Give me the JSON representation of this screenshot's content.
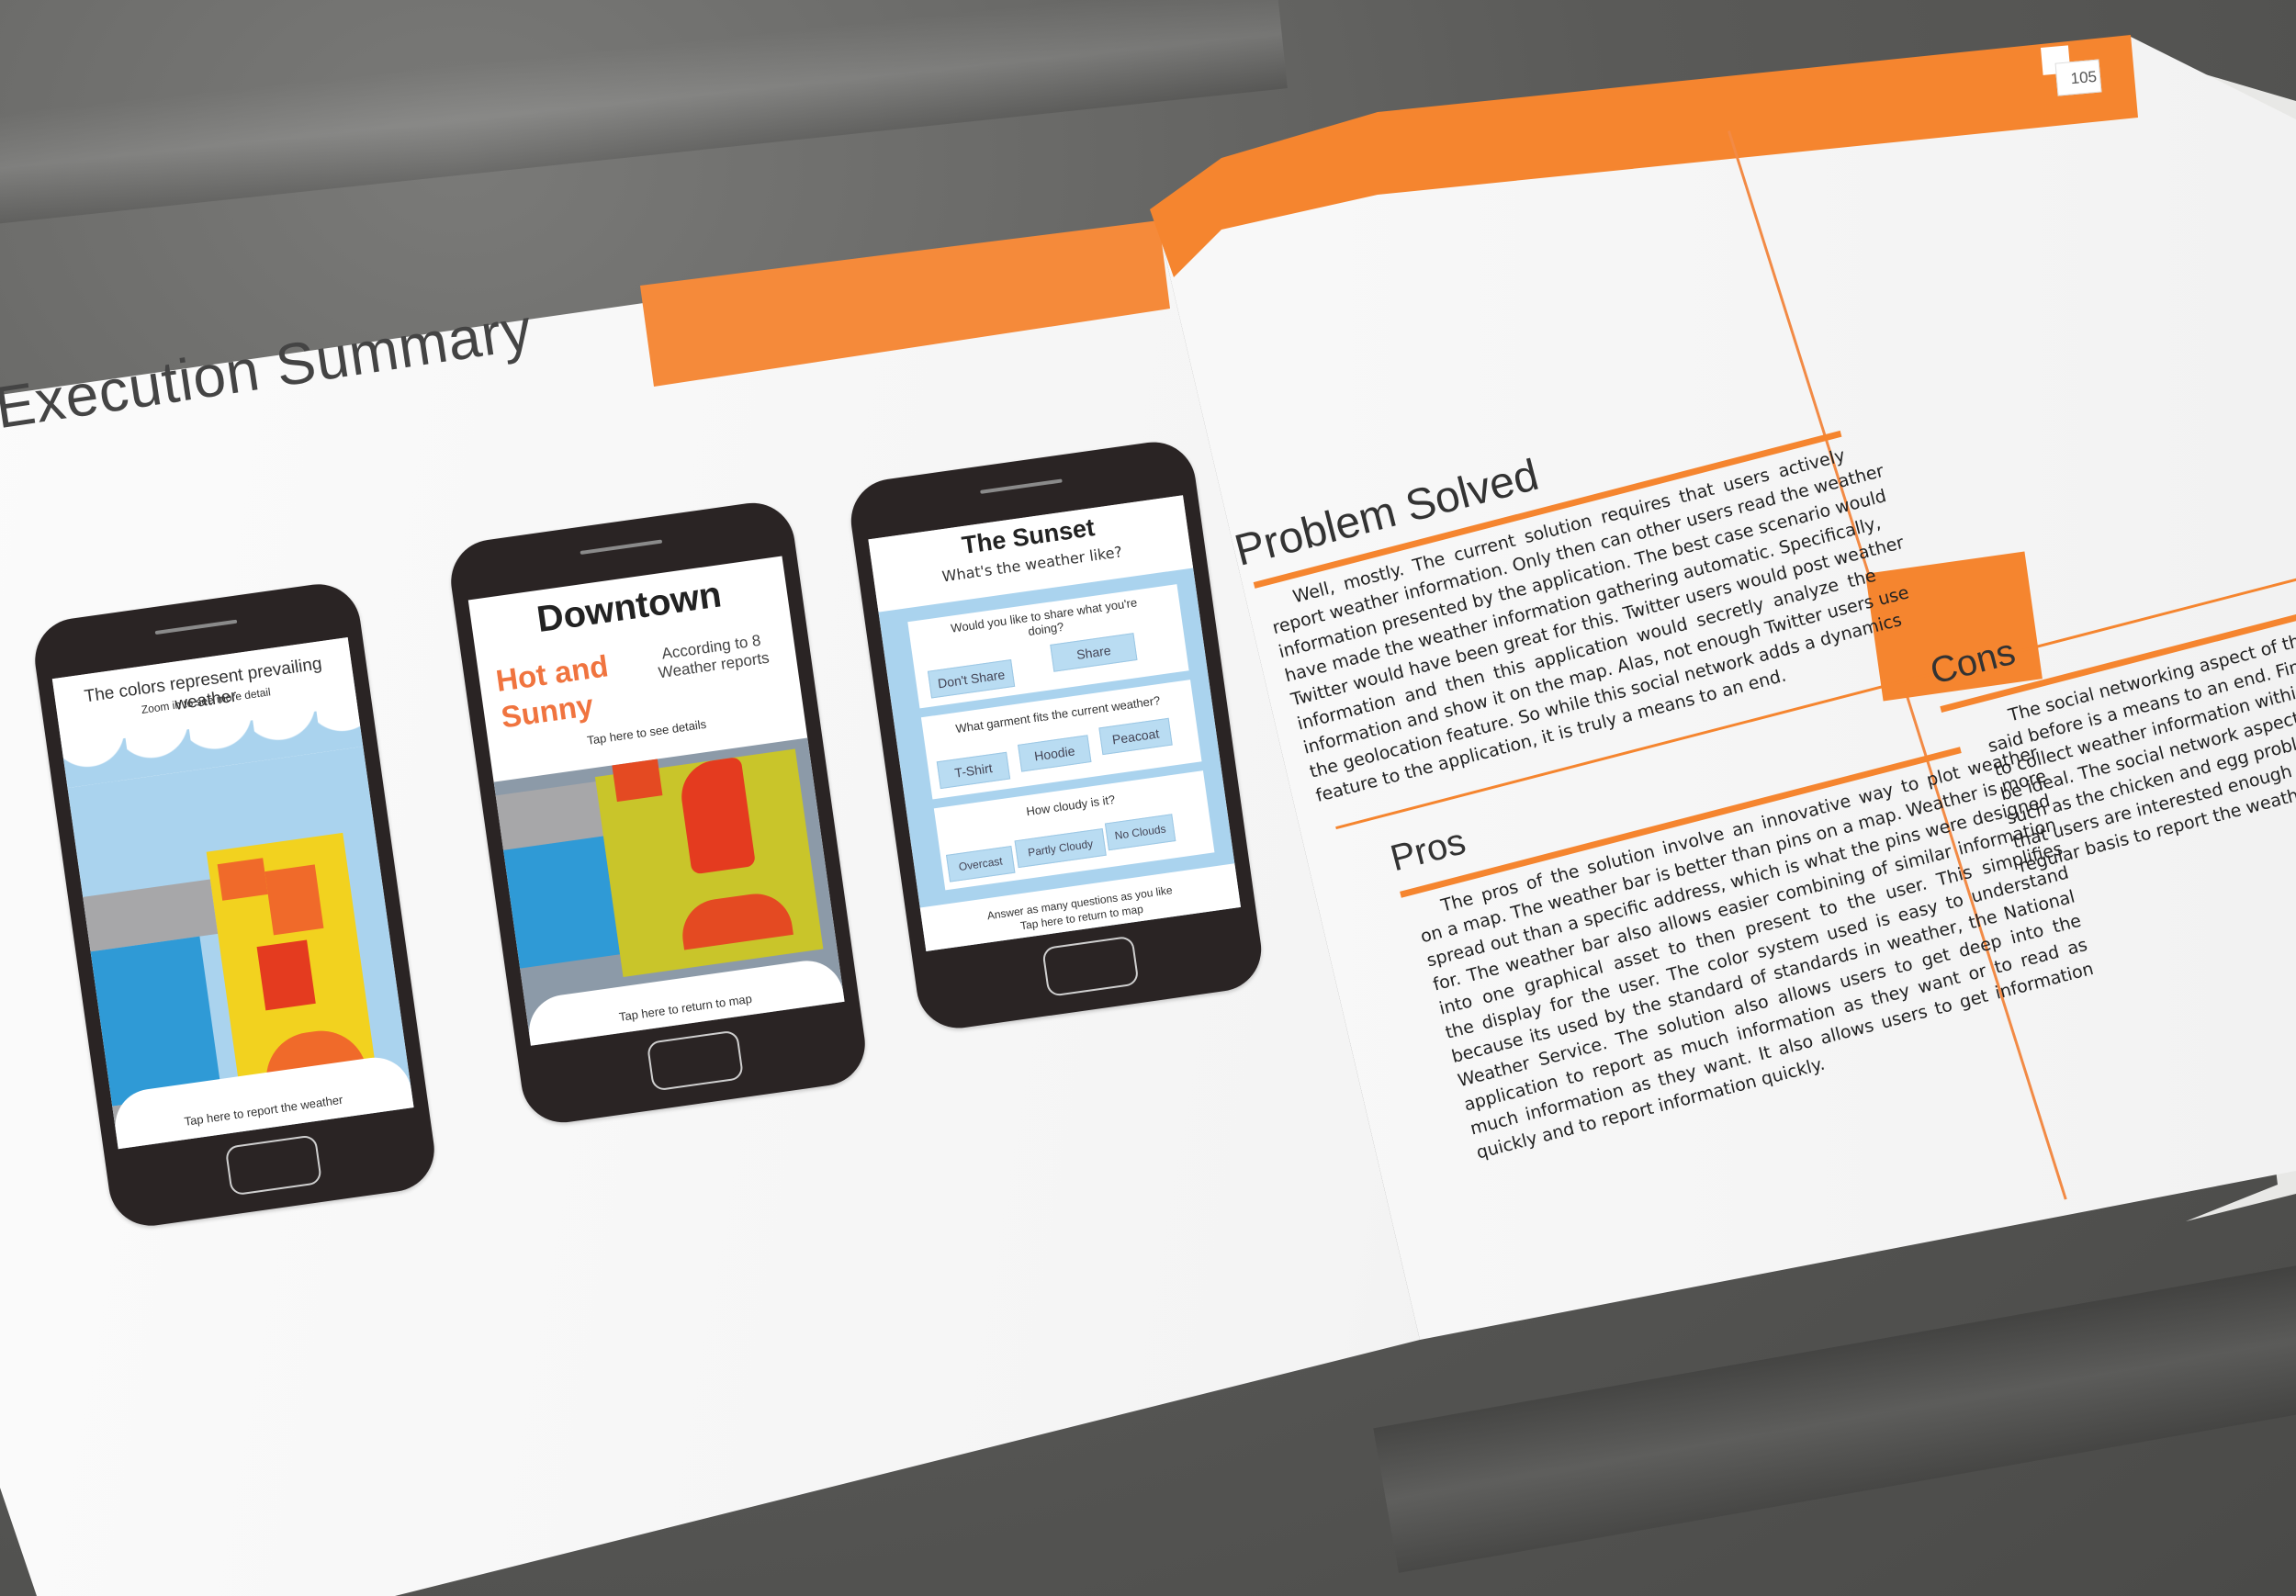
{
  "left_page": {
    "title": "Execution Summary",
    "phones": [
      {
        "header": "The colors represent prevailing weather",
        "subheader": "Zoom in to see more detail",
        "footer": "Tap here to report the weather"
      },
      {
        "title": "Downtown",
        "condition": "Hot and Sunny",
        "reports": "According to 8 Weather reports",
        "details_link": "Tap here to see details",
        "footer": "Tap here to return to map"
      },
      {
        "title": "The Sunset",
        "subtitle": "What's the weather like?",
        "questions": [
          {
            "text": "Would you like to share what you're doing?",
            "options": [
              "Don't Share",
              "Share"
            ]
          },
          {
            "text": "What garment fits the current weather?",
            "options": [
              "T-Shirt",
              "Hoodie",
              "Peacoat"
            ]
          },
          {
            "text": "How cloudy is it?",
            "options": [
              "Overcast",
              "Partly Cloudy",
              "No Clouds"
            ]
          }
        ],
        "footer_1": "Answer as many questions as you like",
        "footer_2": "Tap here to return to map"
      }
    ]
  },
  "right_page": {
    "page_number": "105",
    "problem": {
      "title": "Problem Solved",
      "lines": [
        "Well, mostly. The current solution requires that users actively",
        "report weather information. Only then can other users read the weather",
        "information presented by the application. The best case scenario would",
        "have made the weather information gathering automatic. Specifically,",
        "Twitter would have been great for this. Twitter users would post weather",
        "information and then this application would secretly analyze the",
        "information and show it on the map. Alas, not enough Twitter users use",
        "the geolocation feature. So while this social network adds a dynamics",
        "feature to the application, it is truly a means to an end."
      ]
    },
    "pros": {
      "title": "Pros",
      "lines": [
        "The pros of the solution involve an innovative way to plot weather",
        "on a map. The weather bar is better than pins on a map. Weather is more",
        "spread out than a specific address, which is what the pins were designed",
        "for. The weather bar also allows easier combining of similar information",
        "into one graphical asset to then present to the user. This simplifies",
        "the display for the user. The color system used is easy to understand",
        "because its used by the standard of standards in weather, the National",
        "Weather Service. The solution also allows users to get deep into the",
        "application to report as much information as they want or to read as",
        "much information as they want. It also allows users to get information",
        "quickly and to report information quickly."
      ]
    },
    "cons": {
      "title": "Cons",
      "lines": [
        "The social networking aspect of the solu",
        "said before is a means to an end. Finding and",
        "to collect weather information within the",
        "be ideal. The social network aspect pres",
        "such as the chicken and egg problem. It",
        "that users are interested enough in the",
        "regular basis to report the weather oft"
      ]
    }
  },
  "colors": {
    "accent": "#f5852f",
    "phone": "#2a2424",
    "sky": "#aad3ee",
    "map_yellow": "#f2d21f",
    "map_red": "#e43b1f",
    "map_orange": "#f06a2a",
    "map_gray": "#a7a7a9",
    "map_blue": "#2f9ad6"
  }
}
